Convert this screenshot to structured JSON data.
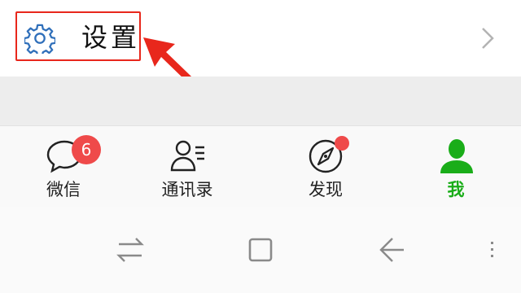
{
  "settings": {
    "label": "设置",
    "icon": "gear-icon",
    "chevron": "chevron-right-icon"
  },
  "annotation": {
    "color": "#e8271c"
  },
  "tabs": [
    {
      "label": "微信",
      "icon": "chat-bubble-icon",
      "badge": "6"
    },
    {
      "label": "通讯录",
      "icon": "contacts-icon"
    },
    {
      "label": "发现",
      "icon": "compass-icon",
      "dot": true
    },
    {
      "label": "我",
      "icon": "person-icon",
      "active": true
    }
  ],
  "colors": {
    "active": "#1aad19",
    "badge": "#ef4a4a",
    "icon_blue": "#2f6fba"
  },
  "nav_buttons": [
    "switch-icon",
    "home-square-icon",
    "back-icon",
    "menu-icon"
  ]
}
